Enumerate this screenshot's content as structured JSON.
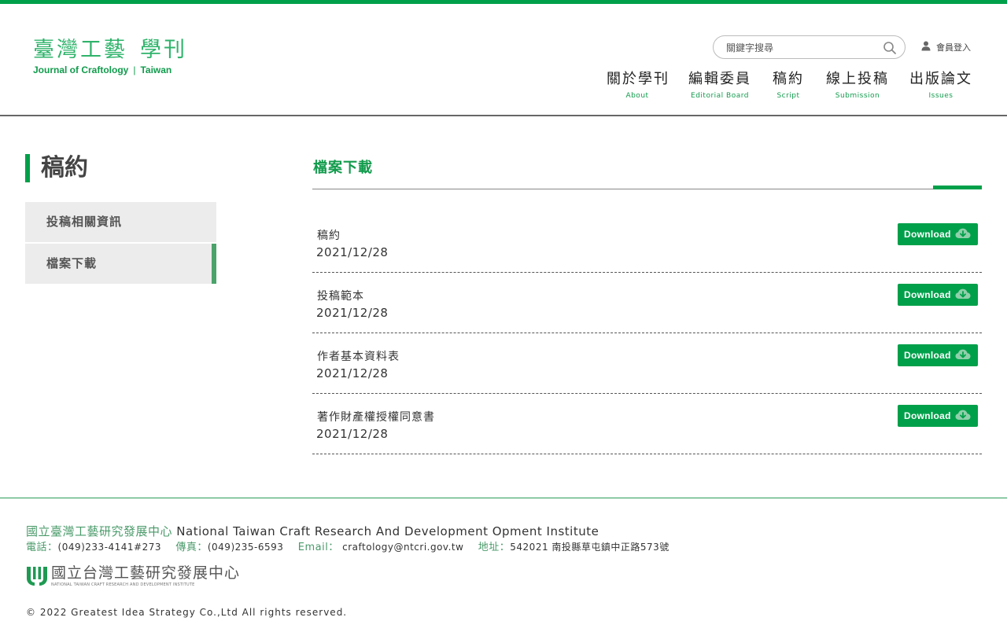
{
  "header": {
    "logo_cn_left": "臺灣工藝",
    "logo_cn_right": "學刊",
    "logo_en_left": "Journal of Craftology",
    "logo_en_sep": "|",
    "logo_en_right": "Taiwan",
    "search_placeholder": "關鍵字搜尋",
    "login_label": "會員登入",
    "nav": [
      {
        "cn": "關於學刊",
        "en": "About"
      },
      {
        "cn": "編輯委員",
        "en": "Editorial Board"
      },
      {
        "cn": "稿約",
        "en": "Script"
      },
      {
        "cn": "線上投稿",
        "en": "Submission"
      },
      {
        "cn": "出版論文",
        "en": "Issues"
      }
    ]
  },
  "sidebar": {
    "title": "稿約",
    "items": [
      {
        "label": "投稿相關資訊"
      },
      {
        "label": "檔案下載"
      }
    ]
  },
  "main": {
    "title": "檔案下載",
    "download_label": "Download",
    "files": [
      {
        "name": "稿約",
        "date": "2021/12/28"
      },
      {
        "name": "投稿範本",
        "date": "2021/12/28"
      },
      {
        "name": "作者基本資料表",
        "date": "2021/12/28"
      },
      {
        "name": "著作財產權授權同意書",
        "date": "2021/12/28"
      }
    ]
  },
  "footer": {
    "org_cn": "國立臺灣工藝研究發展中心",
    "org_en": "National Taiwan Craft Research And Development Opment Institute",
    "phone_label": "電話：",
    "phone": "(049)233-4141#273",
    "fax_label": "傳真：",
    "fax": "(049)235-6593",
    "email_label": "Email：",
    "email": "craftology@ntcri.gov.tw",
    "address_label": "地址：",
    "address": "542021 南投縣草屯鎮中正路573號",
    "logo_cn": "國立台灣工藝研究發展中心",
    "logo_en": "NATIONAL TAIWAN CRAFT RESEARCH AND DEVELOPMENT INSTITUTE",
    "copyright": "© 2022 Greatest Idea Strategy Co.,Ltd All rights reserved."
  },
  "colors": {
    "brand_green": "#00a04a",
    "text_green": "#119b4c",
    "sidebar_bg": "#ececec"
  }
}
